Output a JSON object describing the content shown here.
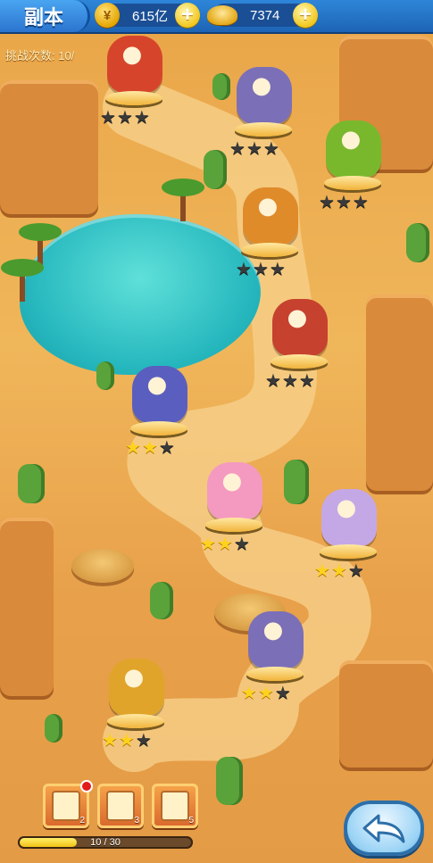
{
  "header": {
    "title": "副本",
    "gold": {
      "icon": "gold-coin-icon",
      "symbol": "¥",
      "value": "615亿"
    },
    "ingot": {
      "icon": "gold-ingot-icon",
      "value": "7374"
    },
    "plus_symbol": "+"
  },
  "challenge_label": "挑战次数: 10/",
  "star_symbol": "★",
  "stages": [
    {
      "name": "stage-dragon-demon",
      "stars": 0,
      "color": "#d6452b"
    },
    {
      "name": "stage-pig-warrior",
      "stars": 0,
      "color": "#7b6fb7"
    },
    {
      "name": "stage-green-beast",
      "stars": 0,
      "color": "#79b82d"
    },
    {
      "name": "stage-pumpkin-mage",
      "stars": 0,
      "color": "#e08b2a"
    },
    {
      "name": "stage-spear-warrior",
      "stars": 0,
      "color": "#c6412e"
    },
    {
      "name": "stage-green-knight",
      "stars": 2,
      "color": "#5a5fbf"
    },
    {
      "name": "stage-pink-fairy",
      "stars": 2,
      "color": "#f49ac0"
    },
    {
      "name": "stage-old-sage",
      "stars": 2,
      "color": "#c4a8e6"
    },
    {
      "name": "stage-pig-warrior-2",
      "stars": 2,
      "color": "#7b6fb7"
    },
    {
      "name": "stage-pineapple-warrior",
      "stars": 2,
      "color": "#e0a42a"
    }
  ],
  "items": [
    {
      "name": "scroll-item-1",
      "count": "2",
      "notify": true
    },
    {
      "name": "scroll-item-2",
      "count": "3",
      "notify": false
    },
    {
      "name": "scroll-item-3",
      "count": "5",
      "notify": false
    }
  ],
  "progress": {
    "text": "10 / 30",
    "value": 10,
    "max": 30
  },
  "back_button": {
    "icon": "back-arrow-icon"
  }
}
